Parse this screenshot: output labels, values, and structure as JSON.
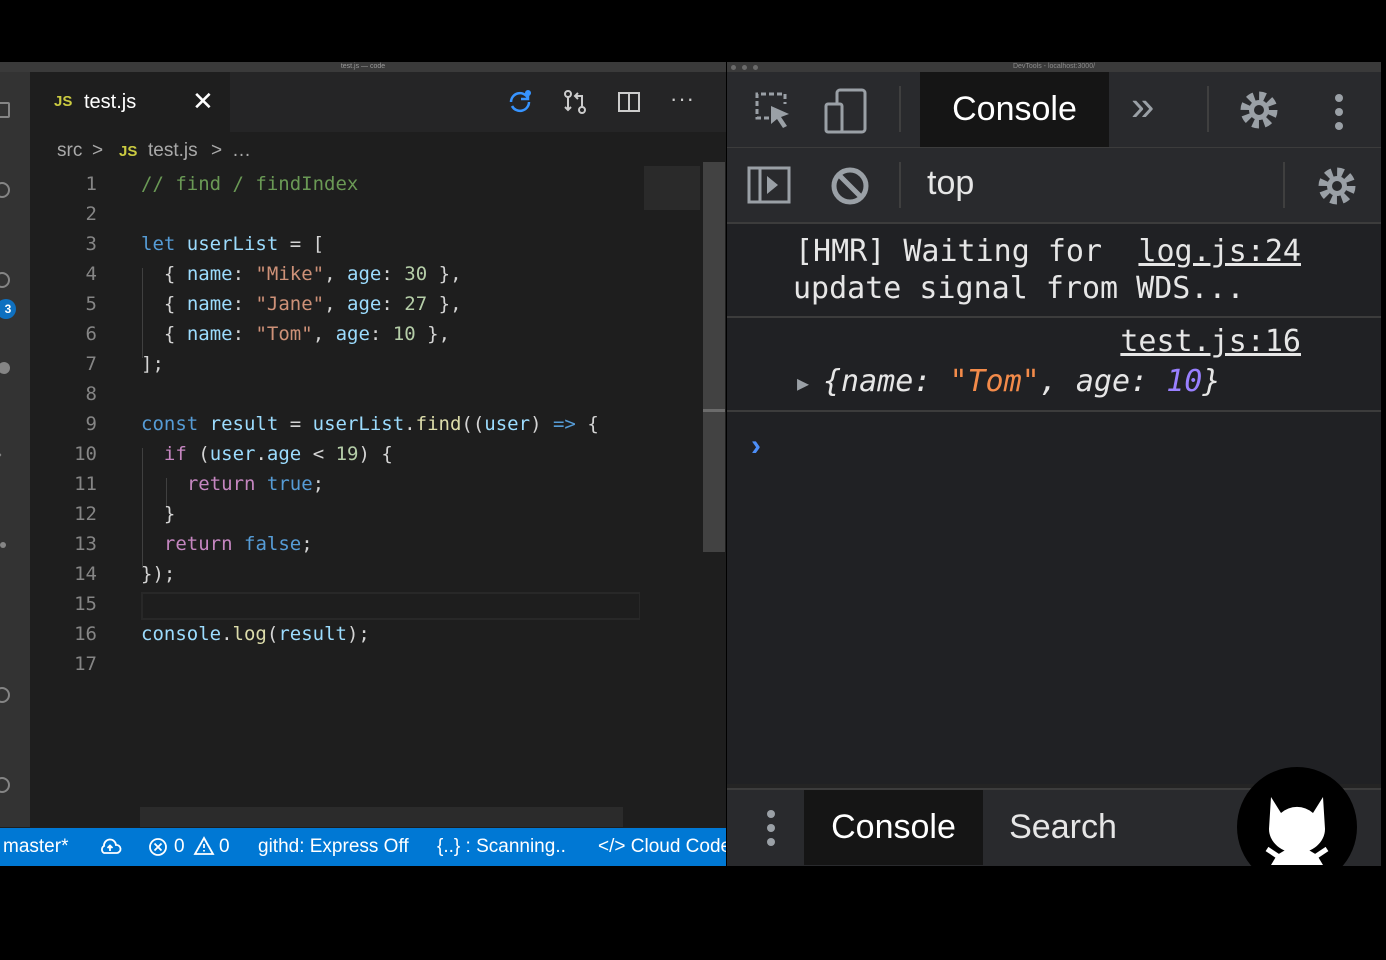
{
  "vscode": {
    "title": "test.js — code",
    "tab": {
      "badge": "JS",
      "label": "test.js",
      "close": "✕"
    },
    "toolbar": [
      "sync-icon",
      "compare-icon",
      "split-editor-icon",
      "more-actions-icon"
    ],
    "toolbar_more": "···",
    "breadcrumb": {
      "folder": "src",
      "sep": ">",
      "badge": "JS",
      "file": "test.js",
      "more": "…"
    },
    "activity_badge": "3",
    "code": [
      {
        "n": "1",
        "text": "// find / findIndex"
      },
      {
        "n": "2",
        "text": ""
      },
      {
        "n": "3",
        "text": "let userList = ["
      },
      {
        "n": "4",
        "text": "  { name: \"Mike\", age: 30 },"
      },
      {
        "n": "5",
        "text": "  { name: \"Jane\", age: 27 },"
      },
      {
        "n": "6",
        "text": "  { name: \"Tom\", age: 10 },"
      },
      {
        "n": "7",
        "text": "];"
      },
      {
        "n": "8",
        "text": ""
      },
      {
        "n": "9",
        "text": "const result = userList.find((user) => {"
      },
      {
        "n": "10",
        "text": "  if (user.age < 19) {"
      },
      {
        "n": "11",
        "text": "    return true;"
      },
      {
        "n": "12",
        "text": "  }"
      },
      {
        "n": "13",
        "text": "  return false;"
      },
      {
        "n": "14",
        "text": "});"
      },
      {
        "n": "15",
        "text": ""
      },
      {
        "n": "16",
        "text": "console.log(result);"
      },
      {
        "n": "17",
        "text": ""
      }
    ],
    "status": {
      "branch": "master*",
      "errors": "0",
      "warnings": "0",
      "githd": "githd: Express Off",
      "scanning": "{..} : Scanning..",
      "cloud": "</> Cloud Code"
    }
  },
  "devtools": {
    "title": "DevTools - localhost:3000/",
    "tabs": {
      "active": "Console",
      "more": "»"
    },
    "context": "top",
    "messages": [
      {
        "line1": "[HMR] Waiting for",
        "line2": "update signal from WDS...",
        "source": "log.js:24"
      },
      {
        "source": "test.js:16",
        "object": {
          "open": "{name: ",
          "name": "\"Tom\"",
          "mid": ", age: ",
          "age": "10",
          "close": "}"
        }
      }
    ],
    "prompt": "›",
    "drawer": {
      "console": "Console",
      "search": "Search"
    }
  }
}
